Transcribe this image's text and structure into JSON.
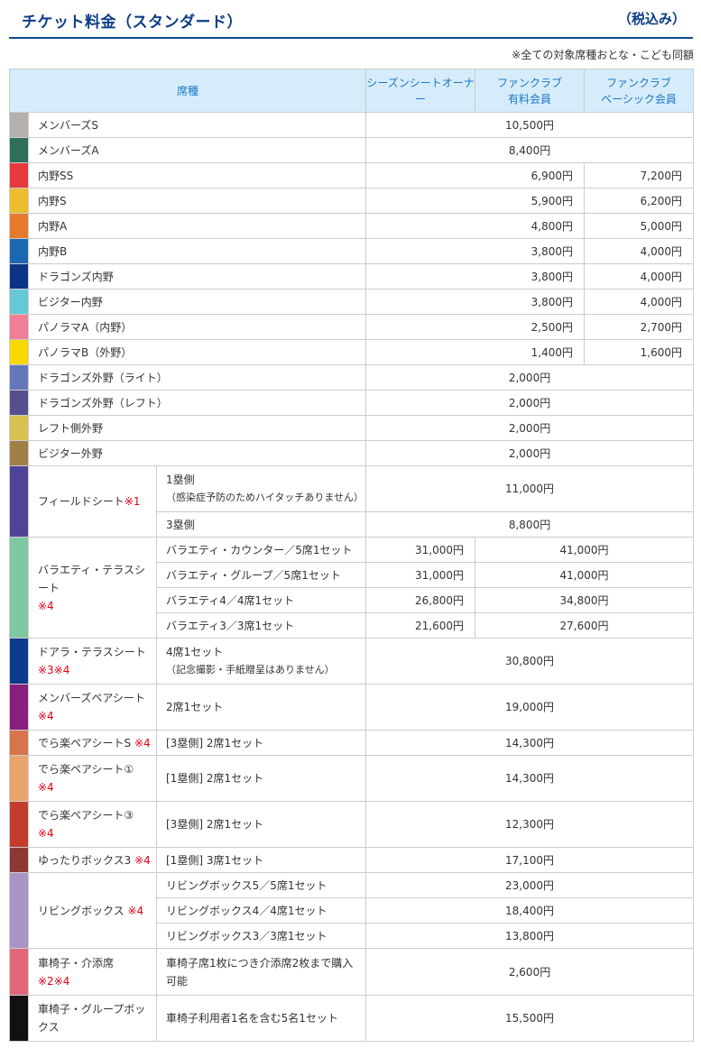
{
  "header": {
    "title": "チケット料金（スタンダード）",
    "tax": "（税込み）"
  },
  "note": "※全ての対象席種おとな・こども同額",
  "columns": {
    "seat": "席種",
    "season": "シーズンシートオーナー",
    "paid_line1": "ファンクラブ",
    "paid_line2": "有料会員",
    "basic_line1": "ファンクラブ",
    "basic_line2": "ベーシック会員"
  },
  "colors": {
    "header_bg": "#d6ecfb",
    "header_text": "#1a76c6",
    "title": "#0d3e84",
    "rule": "#0d4a8f",
    "note_red": "#e60012"
  },
  "simple_rows": [
    {
      "name": "メンバーズS",
      "color": "#b5b0ae",
      "price": "10,500円"
    },
    {
      "name": "メンバーズA",
      "color": "#2f6e57",
      "price": "8,400円"
    },
    {
      "name": "内野SS",
      "color": "#e43a3d",
      "price1": "6,900円",
      "price2": "7,200円"
    },
    {
      "name": "内野S",
      "color": "#ecbd2c",
      "price1": "5,900円",
      "price2": "6,200円"
    },
    {
      "name": "内野A",
      "color": "#e57a2c",
      "price1": "4,800円",
      "price2": "5,000円"
    },
    {
      "name": "内野B",
      "color": "#1c69b2",
      "price1": "3,800円",
      "price2": "4,000円"
    },
    {
      "name": "ドラゴンズ内野",
      "color": "#0b3386",
      "price1": "3,800円",
      "price2": "4,000円"
    },
    {
      "name": "ビジター内野",
      "color": "#66c8d6",
      "price1": "3,800円",
      "price2": "4,000円"
    },
    {
      "name": "パノラマA（内野）",
      "color": "#ef7e97",
      "price1": "2,500円",
      "price2": "2,700円"
    },
    {
      "name": "パノラマB（外野）",
      "color": "#f7d800",
      "price1": "1,400円",
      "price2": "1,600円"
    },
    {
      "name": "ドラゴンズ外野（ライト）",
      "color": "#6477bb",
      "price": "2,000円"
    },
    {
      "name": "ドラゴンズ外野（レフト）",
      "color": "#544f8d",
      "price": "2,000円"
    },
    {
      "name": "レフト側外野",
      "color": "#d9c052",
      "price": "2,000円"
    },
    {
      "name": "ビジター外野",
      "color": "#a07f48",
      "price": "2,000円"
    }
  ],
  "field_seat": {
    "color": "#4f4397",
    "name": "フィールドシート",
    "mark": "※1",
    "sub1_line1": "1塁側",
    "sub1_line2": "（感染症予防のためハイタッチありません）",
    "sub1_price": "11,000円",
    "sub2": "3塁側",
    "sub2_price": "8,800円"
  },
  "variety": {
    "color": "#7fc8a2",
    "name": "バラエティ・テラスシート",
    "mark": "※4",
    "rows": [
      {
        "desc": "バラエティ・カウンター／5席1セット",
        "p1": "31,000円",
        "p2": "41,000円"
      },
      {
        "desc": "バラエティ・グループ／5席1セット",
        "p1": "31,000円",
        "p2": "41,000円"
      },
      {
        "desc": "バラエティ4／4席1セット",
        "p1": "26,800円",
        "p2": "34,800円"
      },
      {
        "desc": "バラエティ3／3席1セット",
        "p1": "21,600円",
        "p2": "27,600円"
      }
    ]
  },
  "doara": {
    "color": "#0e3a8e",
    "name": "ドアラ・テラスシート",
    "mark": "※3※4",
    "desc_line1": "4席1セット",
    "desc_line2": "（記念撮影・手紙贈呈はありません）",
    "price": "30,800円"
  },
  "members_pair": {
    "color": "#8a1e7f",
    "name": "メンバーズペアシート",
    "mark": "※4",
    "desc": "2席1セット",
    "price": "19,000円"
  },
  "deraraku_s": {
    "color": "#d7744b",
    "name": "でら楽ペアシートS",
    "mark": "※4",
    "desc": "[3塁側] 2席1セット",
    "price": "14,300円"
  },
  "deraraku_1": {
    "color": "#e8a46a",
    "name": "でら楽ペアシート①",
    "mark": "※4",
    "desc": "[1塁側] 2席1セット",
    "price": "14,300円"
  },
  "deraraku_3": {
    "color": "#c23d2c",
    "name": "でら楽ペアシート③",
    "mark": "※4",
    "desc": "[3塁側] 2席1セット",
    "price": "12,300円"
  },
  "yuttari": {
    "color": "#8a3a32",
    "name": "ゆったりボックス3",
    "mark": "※4",
    "desc": "[1塁側] 3席1セット",
    "price": "17,100円"
  },
  "living": {
    "color": "#a995c5",
    "name": "リビングボックス",
    "mark": "※4",
    "rows": [
      {
        "desc": "リビングボックス5／5席1セット",
        "price": "23,000円"
      },
      {
        "desc": "リビングボックス4／4席1セット",
        "price": "18,400円"
      },
      {
        "desc": "リビングボックス3／3席1セット",
        "price": "13,800円"
      }
    ]
  },
  "wheelchair": {
    "color": "#e1677a",
    "name": "車椅子・介添席",
    "mark": "※2※4",
    "desc": "車椅子席1枚につき介添席2枚まで購入可能",
    "price": "2,600円"
  },
  "wheelchair_group": {
    "color": "#111111",
    "name": "車椅子・グループボックス",
    "desc": "車椅子利用者1名を含む5名1セット",
    "price": "15,500円"
  }
}
